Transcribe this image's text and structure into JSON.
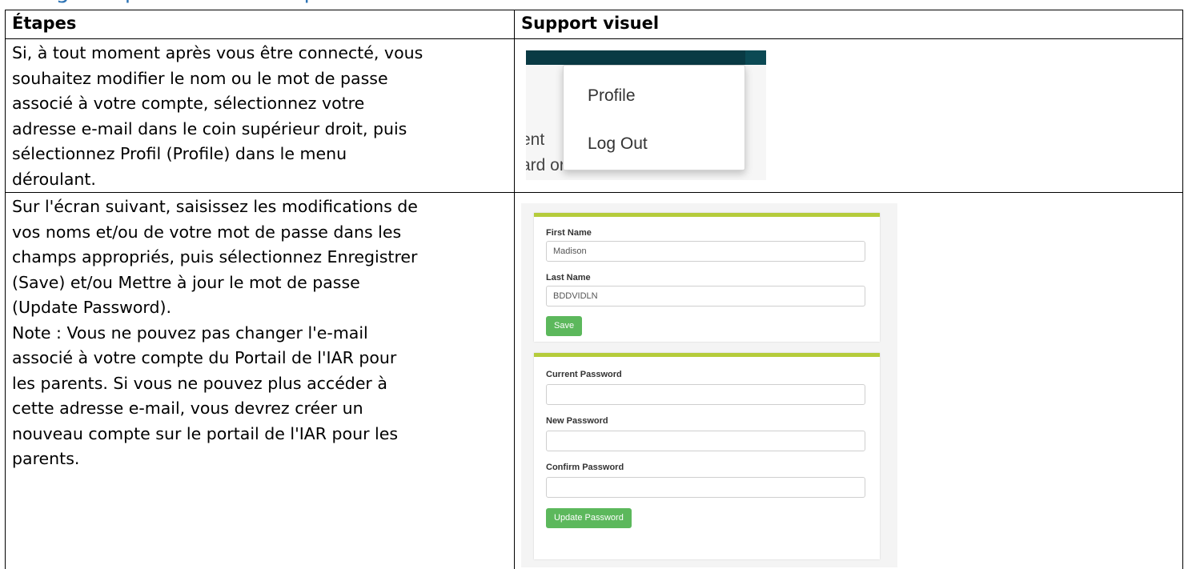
{
  "heading": {
    "partial_text": "Changer le profil ou mot de passe"
  },
  "table": {
    "headers": {
      "steps": "Étapes",
      "visual": "Support visuel"
    },
    "rows": [
      {
        "lines": [
          "Si, à tout moment après vous être connecté, vous",
          "souhaitez modifier le nom ou le mot de passe",
          "associé à votre compte, sélectionnez votre",
          "adresse e-mail dans le coin supérieur droit, puis",
          "sélectionnez Profil (Profile) dans le menu",
          "déroulant."
        ]
      },
      {
        "lines": [
          "Sur l'écran suivant, saisissez les modifications de",
          "vos noms et/ou de votre mot de passe dans les",
          "champs appropriés, puis sélectionnez Enregistrer",
          "(Save) et/ou Mettre à jour le mot de passe",
          "(Update Password).",
          "Note : Vous ne pouvez pas changer l'e-mail",
          "associé à votre compte du Portail de l'IAR pour",
          "les parents. Si vous ne pouvez plus accéder à",
          "cette adresse e-mail, vous devrez créer un",
          "nouveau compte sur le portail de l'IAR pour les",
          "parents."
        ]
      }
    ]
  },
  "dropdown_screenshot": {
    "menu_items": [
      "Profile",
      "Log Out"
    ],
    "background_text": [
      "ent",
      "ard or media."
    ],
    "topbar_color": "#093a44"
  },
  "profile_screenshot": {
    "name_panel": {
      "first_name_label": "First Name",
      "first_name_value": "Madison",
      "last_name_label": "Last Name",
      "last_name_value": "BDDVIDLN",
      "save_label": "Save"
    },
    "password_panel": {
      "current_password_label": "Current Password",
      "new_password_label": "New Password",
      "confirm_password_label": "Confirm Password",
      "update_label": "Update Password"
    },
    "accent_color": "#b5cc3b",
    "button_color": "#5cb85c"
  }
}
